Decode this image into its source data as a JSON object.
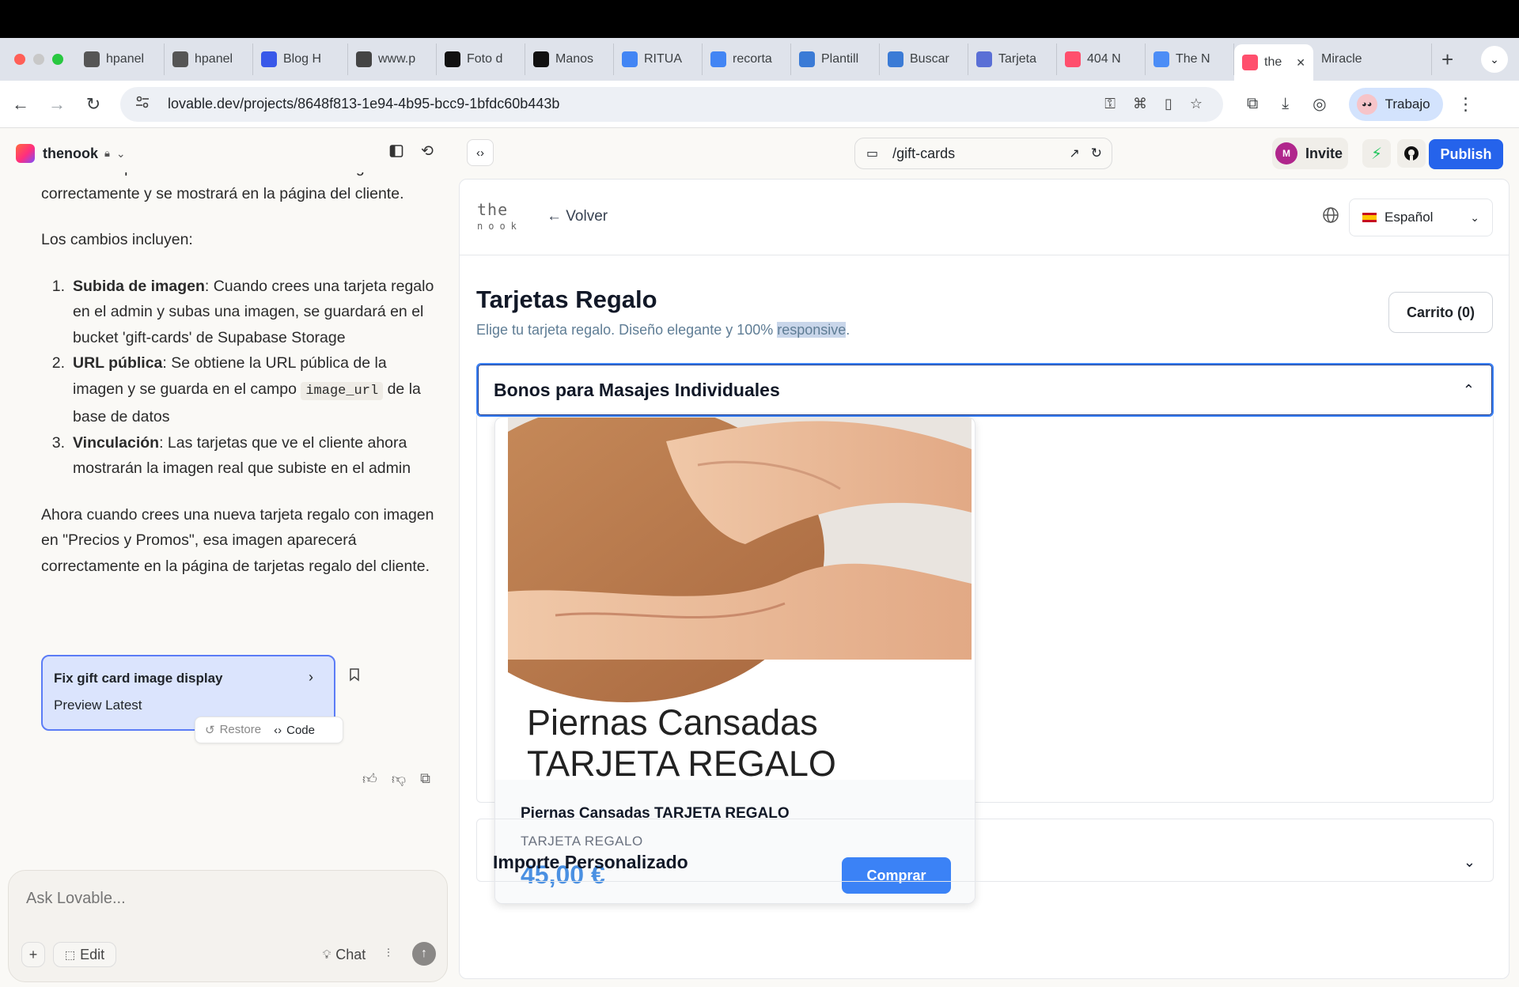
{
  "browser": {
    "tabs": [
      {
        "label": "hpanel",
        "icon": "hostinger-icon",
        "color": "#555"
      },
      {
        "label": "hpanel",
        "icon": "hostinger-icon",
        "color": "#555"
      },
      {
        "label": "Blog H",
        "icon": "wordpress-icon",
        "color": "#3858e9"
      },
      {
        "label": "www.p",
        "icon": "heart-icon",
        "color": "#444"
      },
      {
        "label": "Foto d",
        "icon": "picsart-icon",
        "color": "#111"
      },
      {
        "label": "Manos",
        "icon": "istock-icon",
        "color": "#111"
      },
      {
        "label": "RITUA",
        "icon": "google-icon",
        "color": "#4285f4"
      },
      {
        "label": "recorta",
        "icon": "google-icon",
        "color": "#4285f4"
      },
      {
        "label": "Plantill",
        "icon": "canva-icon",
        "color": "#3b7bd6"
      },
      {
        "label": "Buscar",
        "icon": "canva-icon",
        "color": "#3b7bd6"
      },
      {
        "label": "Tarjeta",
        "icon": "printer-icon",
        "color": "#5a6fd6"
      },
      {
        "label": "404 N",
        "icon": "lovable-icon",
        "color": "#ff4f6d"
      },
      {
        "label": "The N",
        "icon": "gear-flower-icon",
        "color": "#4c8df6"
      },
      {
        "label": "the",
        "icon": "lovable-icon",
        "color": "#ff4f6d",
        "active": true
      },
      {
        "label": "Miracle",
        "icon": "",
        "color": ""
      }
    ],
    "url": "lovable.dev/projects/8648f813-1e94-4b95-bcc9-1bfdc60b443b",
    "profile_label": "Trabajo"
  },
  "app": {
    "project_name": "thenook",
    "chat": {
      "cut_top_line": "subas en el panel de administración ahora se guardará",
      "intro_line": "correctamente y se mostrará en la página del cliente.",
      "changes_heading": "Los cambios incluyen:",
      "items": [
        {
          "num": "1.",
          "bold": "Subida de imagen",
          "rest": ": Cuando crees una tarjeta regalo en el admin y subas una imagen, se guardará en el bucket 'gift-cards' de Supabase Storage"
        },
        {
          "num": "2.",
          "bold": "URL pública",
          "rest_a": ": Se obtiene la URL pública de la imagen y se guarda en el campo ",
          "code": "image_url",
          "rest_b": " de la base de datos"
        },
        {
          "num": "3.",
          "bold": "Vinculación",
          "rest": ": Las tarjetas que ve el cliente ahora mostrarán la imagen real que subiste en el admin"
        }
      ],
      "closing": "Ahora cuando crees una nueva tarjeta regalo con imagen en \"Precios y Promos\", esa imagen aparecerá correctamente en la página de tarjetas regalo del cliente.",
      "fix_card": {
        "title": "Fix gift card image display",
        "subtitle": "Preview Latest"
      },
      "restore_label": "Restore",
      "code_label": "Code"
    },
    "input": {
      "placeholder": "Ask Lovable...",
      "edit_label": "Edit",
      "chat_label": "Chat"
    },
    "toolbar": {
      "route": "/gift-cards",
      "invite_label": "Invite",
      "avatar_initial": "M",
      "publish_label": "Publish"
    }
  },
  "preview": {
    "logo_top": "the",
    "logo_bottom": "nook",
    "back_label": "← Volver",
    "language": "Español",
    "title": "Tarjetas Regalo",
    "subtitle_pre": "Elige tu tarjeta regalo. Diseño elegante y 100% ",
    "subtitle_highlight": "responsive",
    "subtitle_post": ".",
    "cart_label": "Carrito (0)",
    "section1_title": "Bonos para Masajes Individuales",
    "card": {
      "image_text_line1": "Piernas Cansadas",
      "image_text_line2": "TARJETA REGALO",
      "name": "Piernas Cansadas TARJETA REGALO",
      "category": "TARJETA REGALO",
      "price": "45,00 €",
      "buy_label": "Comprar"
    },
    "section2_title": "Importe Personalizado",
    "colors": {
      "primary": "#3b82f6",
      "price": "#4a90e2",
      "publish": "#2563eb"
    }
  }
}
